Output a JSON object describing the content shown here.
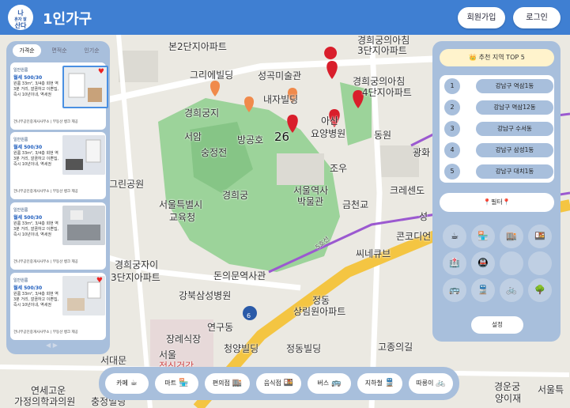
{
  "header": {
    "logo_text_top": "나",
    "logo_text_mid": "혼자 잘",
    "logo_text_bottom": "산다",
    "title": "1인가구",
    "signup_label": "회원가입",
    "login_label": "로그인"
  },
  "map": {
    "labels": [
      "경희궁의아침",
      "본2단지아파트",
      "3단지아파트",
      "그리에빌딩",
      "성곡미술관",
      "내자빌딩",
      "경희궁의아침",
      "4단지아파트",
      "경희궁지",
      "서암",
      "숭정전",
      "방공호",
      "아산",
      "요양병원",
      "동원",
      "광화",
      "조우",
      "그린공원",
      "경희궁",
      "서울역사",
      "박물관",
      "서울특별시",
      "교육청",
      "크레센도",
      "금천교",
      "성",
      "콘코디언",
      "씨네큐브",
      "경희궁자이",
      "3단지아파트",
      "돈의문역사관",
      "강북삼성병원",
      "정동",
      "상림원아파트",
      "연구동",
      "장례식장",
      "청양빌딩",
      "정동빌딩",
      "고종의길",
      "서대문",
      "서울",
      "정신건강",
      "연세고운",
      "가정의학과의원",
      "충정빌딩",
      "경운궁",
      "양이재",
      "서울특",
      "5호선"
    ],
    "cluster_count": "26",
    "road_badge": "6"
  },
  "sort_tabs": [
    {
      "label": "가격순",
      "active": true
    },
    {
      "label": "면적순",
      "active": false
    },
    {
      "label": "인기순",
      "active": false
    }
  ],
  "listings": [
    {
      "category": "일반원룸",
      "price": "월세 500/30",
      "desc": "원룸 33m², 3/4층 회현 역 3분 거리, 깔끔하고 이쁜집, 즉시 10년이내, 역세권",
      "agent": "건나무공인중개사사무소 | 부동산 뱅크 제공",
      "heart": "♥"
    },
    {
      "category": "일반원룸",
      "price": "월세 500/30",
      "desc": "원룸 33m², 3/4층 회현 역 3분 거리, 깔끔하고 이쁜집, 즉시 10년이내, 역세권",
      "agent": "건나무공인중개사사무소 | 부동산 뱅크 제공",
      "heart": ""
    },
    {
      "category": "일반원룸",
      "price": "월세 500/30",
      "desc": "원룸 33m², 3/4층 회현 역 3분 거리, 깔끔하고 이쁜집, 즉시 10년이내, 역세권",
      "agent": "건나무공인중개사사무소 | 부동산 뱅크 제공",
      "heart": ""
    },
    {
      "category": "일반원룸",
      "price": "월세 500/30",
      "desc": "원룸 33m², 3/4층 회현 역 3분 거리, 깔끔하고 이쁜집, 즉시 10년이내, 역세권",
      "agent": "건나무공인중개사사무소 | 부동산 뱅크 제공",
      "heart": "♥"
    }
  ],
  "pager": "◀ ▶",
  "recommend": {
    "title": "👑 추천 지역 TOP 5",
    "items": [
      {
        "rank": "1",
        "name": "강남구 역삼1동"
      },
      {
        "rank": "2",
        "name": "강남구 역삼12동"
      },
      {
        "rank": "3",
        "name": "강남구 수서동"
      },
      {
        "rank": "4",
        "name": "강남구 삼성1동"
      },
      {
        "rank": "5",
        "name": "강남구 대치1동"
      }
    ]
  },
  "filter": {
    "title": "📍필터📍",
    "icons": [
      {
        "name": "cafe-filter-icon",
        "glyph": "☕"
      },
      {
        "name": "mart-filter-icon",
        "glyph": "🏪"
      },
      {
        "name": "convenience-filter-icon",
        "glyph": "🏬"
      },
      {
        "name": "restaurant-filter-icon",
        "glyph": "🍱"
      },
      {
        "name": "hospital-filter-icon",
        "glyph": "🏥"
      },
      {
        "name": "subway-line-filter-icon",
        "glyph": "🚇"
      },
      {
        "name": "empty-slot-1",
        "glyph": ""
      },
      {
        "name": "empty-slot-2",
        "glyph": ""
      },
      {
        "name": "bus-filter-icon",
        "glyph": "🚌"
      },
      {
        "name": "subway-filter-icon",
        "glyph": "🚆"
      },
      {
        "name": "bike-filter-icon",
        "glyph": "🚲"
      },
      {
        "name": "park-filter-icon",
        "glyph": "🌳"
      }
    ],
    "settings_label": "설정"
  },
  "bottom_bar": [
    {
      "label": "카페",
      "icon": "☕"
    },
    {
      "label": "마트",
      "icon": "🏪"
    },
    {
      "label": "편의점",
      "icon": "🏬"
    },
    {
      "label": "음식점",
      "icon": "🍱"
    },
    {
      "label": "버스",
      "icon": "🚌"
    },
    {
      "label": "지하철",
      "icon": "🚆"
    },
    {
      "label": "따릉이",
      "icon": "🚲"
    }
  ]
}
